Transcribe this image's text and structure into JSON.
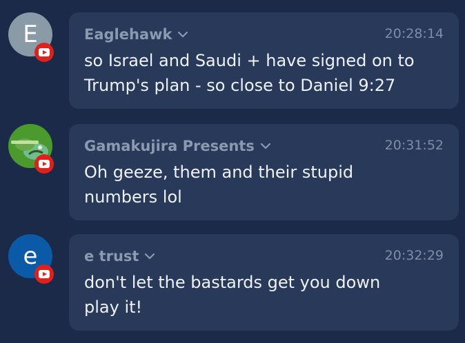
{
  "messages": [
    {
      "avatar_letter": "E",
      "avatar_kind": "letter",
      "avatar_color": "#8a9aa6",
      "name": "Eaglehawk",
      "time": "20:28:14",
      "text": "so Israel and Saudi + have signed on to\nTrump's plan - so close to Daniel 9:27",
      "badge_icon": "youtube-icon"
    },
    {
      "avatar_kind": "image",
      "name": "Gamakujira Presents",
      "time": "20:31:52",
      "text": "Oh geeze, them and their stupid\nnumbers lol",
      "badge_icon": "youtube-icon"
    },
    {
      "avatar_letter": "e",
      "avatar_kind": "letter",
      "avatar_color": "#0b5aa8",
      "name": "e trust",
      "time": "20:32:29",
      "text": "don't let the bastards get you down\nplay it!",
      "badge_icon": "youtube-icon"
    }
  ],
  "colors": {
    "background": "#1b2a48",
    "bubble": "#293959",
    "name": "#8c9ab1",
    "time": "#7f8da6",
    "text": "#eef2f8",
    "youtube_red": "#e0201b"
  }
}
